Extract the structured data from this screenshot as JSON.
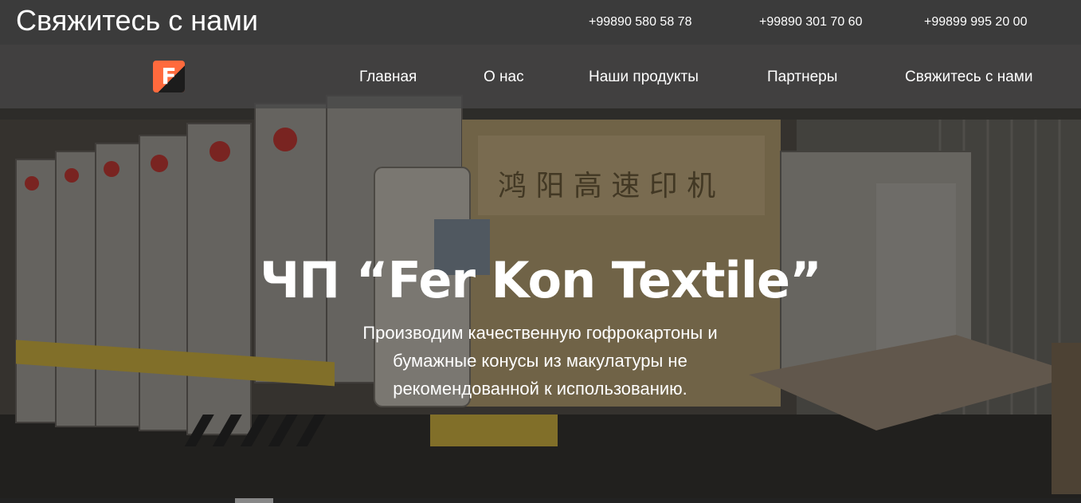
{
  "header": {
    "contact_title": "Свяжитесь с нами",
    "phones": [
      "+99890 580 58 78",
      "+99890 301 70 60",
      "+99899 995 20 00"
    ]
  },
  "nav": {
    "logo_letter": "F",
    "items": [
      {
        "label": "Главная"
      },
      {
        "label": "О нас"
      },
      {
        "label": "Наши продукты"
      },
      {
        "label": "Партнеры"
      },
      {
        "label": "Свяжитесь с нами"
      }
    ]
  },
  "hero": {
    "title": "ЧП “Fer Kon Textile”",
    "subtitle": "Производим качественную гофрокартоны и бумажные конусы из макулатуры не рекомендованной к использованию.",
    "machine_sign": "鸿 阳 高 速 印 机"
  },
  "colors": {
    "topbar_bg": "#3b3b3b",
    "logo_orange": "#ff6a3d",
    "text": "#ffffff"
  }
}
